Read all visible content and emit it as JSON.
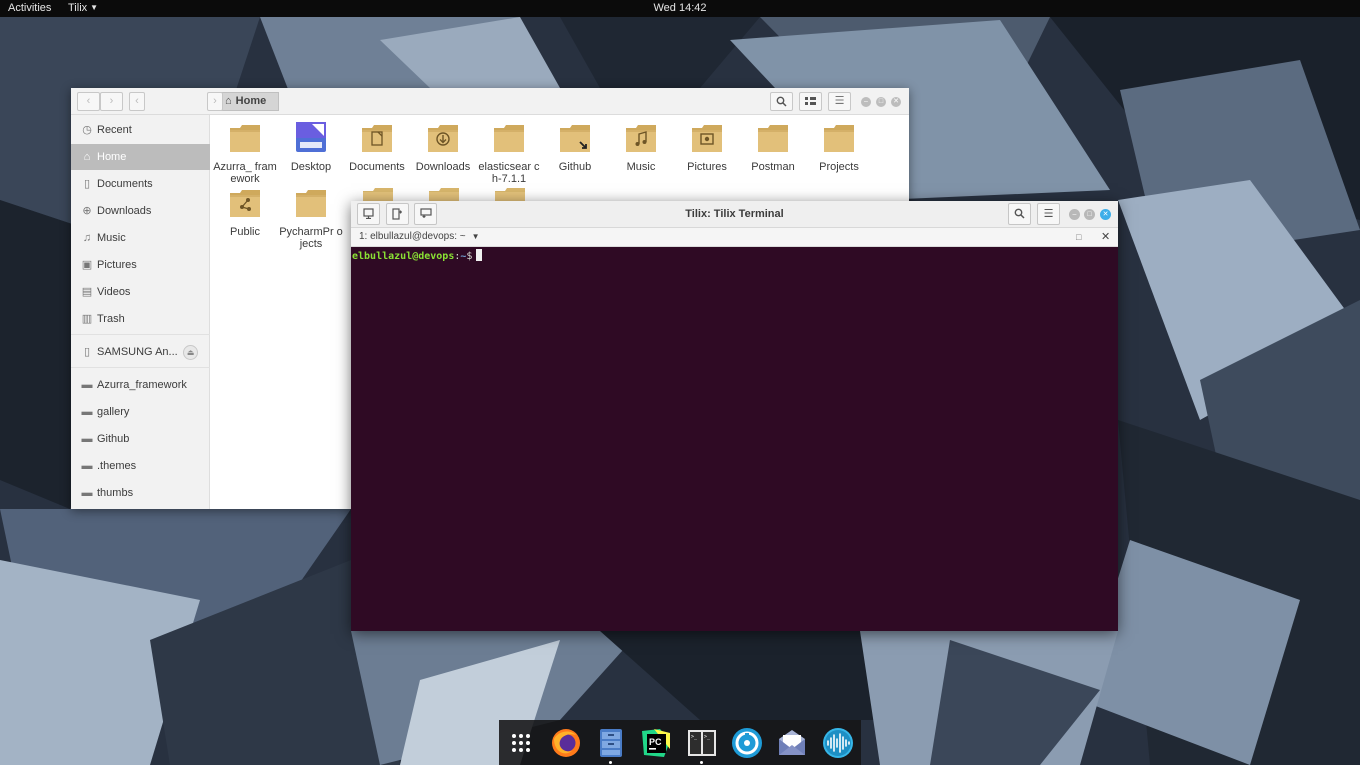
{
  "topbar": {
    "activities": "Activities",
    "app_menu": "Tilix",
    "clock": "Wed 14:42"
  },
  "files": {
    "path_home": "Home",
    "sidebar": [
      {
        "label": "Recent",
        "icon": "clock-icon",
        "glyph": "◷",
        "active": false
      },
      {
        "label": "Home",
        "icon": "home-icon",
        "glyph": "⌂",
        "active": true
      },
      {
        "label": "Documents",
        "icon": "document-icon",
        "glyph": "▯",
        "active": false
      },
      {
        "label": "Downloads",
        "icon": "download-icon",
        "glyph": "⊕",
        "active": false
      },
      {
        "label": "Music",
        "icon": "music-icon",
        "glyph": "♫",
        "active": false
      },
      {
        "label": "Pictures",
        "icon": "pictures-icon",
        "glyph": "▣",
        "active": false
      },
      {
        "label": "Videos",
        "icon": "video-icon",
        "glyph": "▤",
        "active": false
      },
      {
        "label": "Trash",
        "icon": "trash-icon",
        "glyph": "▥",
        "active": false
      }
    ],
    "device": {
      "label": "SAMSUNG An...",
      "icon": "phone-icon"
    },
    "bookmarks": [
      {
        "label": "Azurra_framework"
      },
      {
        "label": "gallery"
      },
      {
        "label": "Github"
      },
      {
        "label": ".themes"
      },
      {
        "label": "thumbs"
      }
    ],
    "items": [
      {
        "label": "Azurra_ framework",
        "emblem": ""
      },
      {
        "label": "Desktop",
        "emblem": "desktop"
      },
      {
        "label": "Documents",
        "emblem": "document"
      },
      {
        "label": "Downloads",
        "emblem": "download"
      },
      {
        "label": "elasticsear ch-7.1.1",
        "emblem": ""
      },
      {
        "label": "Github",
        "emblem": "link"
      },
      {
        "label": "Music",
        "emblem": "music"
      },
      {
        "label": "Pictures",
        "emblem": "pictures"
      },
      {
        "label": "Postman",
        "emblem": ""
      },
      {
        "label": "Projects",
        "emblem": ""
      },
      {
        "label": "Public",
        "emblem": "share"
      },
      {
        "label": "PycharmPr ojects",
        "emblem": ""
      }
    ]
  },
  "terminal": {
    "title": "Tilix: Tilix Terminal",
    "session": "1: elbullazul@devops: ~",
    "prompt_user": "elbullazul@devops",
    "prompt_sep": ":",
    "prompt_path": "~",
    "prompt_symbol": "$"
  },
  "dock": {
    "apps": [
      {
        "name": "app-grid-icon",
        "running": false
      },
      {
        "name": "firefox-icon",
        "running": false
      },
      {
        "name": "files-icon",
        "running": true
      },
      {
        "name": "pycharm-icon",
        "running": false
      },
      {
        "name": "tilix-icon",
        "running": true
      },
      {
        "name": "mailspring-icon",
        "running": false
      },
      {
        "name": "mail-icon",
        "running": false
      },
      {
        "name": "audio-wave-icon",
        "running": false
      }
    ]
  },
  "colors": {
    "terminal_bg": "#2f0a24",
    "prompt_user": "#8ae234",
    "prompt_path": "#729fcf",
    "folder": "#d8b66c",
    "accent": "#3daee9"
  }
}
